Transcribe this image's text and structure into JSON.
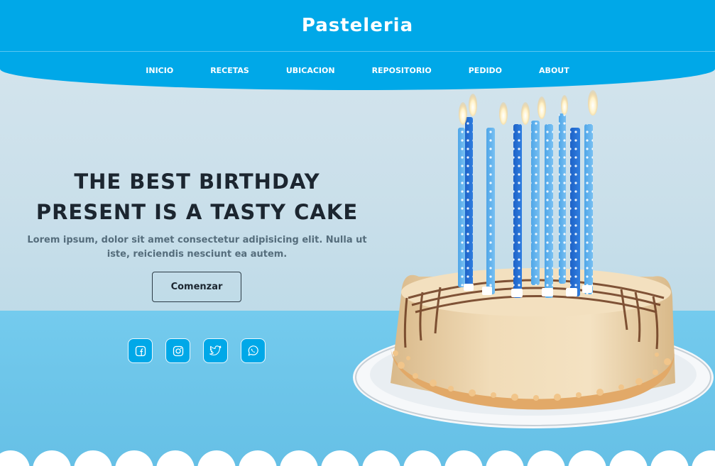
{
  "header": {
    "title": "Pasteleria"
  },
  "nav": {
    "items": [
      {
        "label": "INICIO"
      },
      {
        "label": "RECETAS"
      },
      {
        "label": "UBICACION"
      },
      {
        "label": "REPOSITORIO"
      },
      {
        "label": "PEDIDO"
      },
      {
        "label": "ABOUT"
      }
    ]
  },
  "hero": {
    "headline": "THE BEST BIRTHDAY PRESENT IS A TASTY CAKE",
    "subtext": "Lorem ipsum, dolor sit amet consectetur adipisicing elit. Nulla ut iste, reiciendis nesciunt ea autem.",
    "cta_label": "Comenzar"
  },
  "social": [
    {
      "icon": "facebook-icon"
    },
    {
      "icon": "instagram-icon"
    },
    {
      "icon": "twitter-icon"
    },
    {
      "icon": "whatsapp-icon"
    }
  ],
  "colors": {
    "brand": "#00a8e8",
    "heading": "#1c2630",
    "subtext": "#556d7c",
    "table": "#6ec6ea"
  }
}
